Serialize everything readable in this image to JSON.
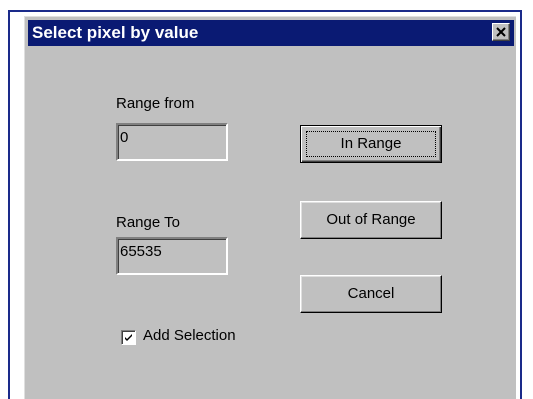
{
  "window": {
    "title": "Select pixel by value"
  },
  "range_from": {
    "label": "Range from",
    "value": "0"
  },
  "range_to": {
    "label": "Range To",
    "value": "65535"
  },
  "buttons": {
    "in_range": "In Range",
    "out_of_range": "Out of Range",
    "cancel": "Cancel"
  },
  "add_selection": {
    "label": "Add Selection",
    "checked": true
  },
  "icons": {
    "close": "close-icon",
    "check": "checkmark-icon"
  },
  "colors": {
    "titlebar": "#0a1a73",
    "dialog_face": "#c0c0c0"
  }
}
